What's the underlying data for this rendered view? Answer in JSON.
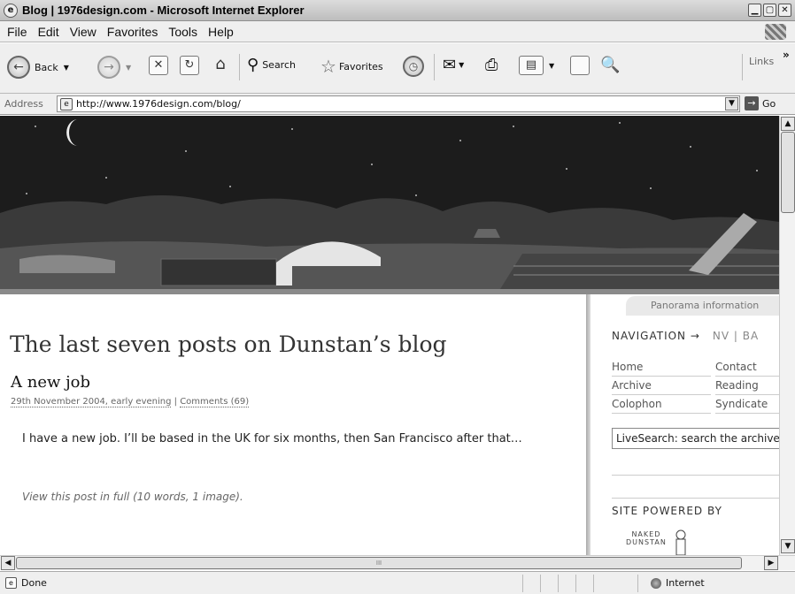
{
  "window": {
    "title": "Blog | 1976design.com - Microsoft Internet Explorer",
    "app_icon": "ie-icon"
  },
  "menu": [
    "File",
    "Edit",
    "View",
    "Favorites",
    "Tools",
    "Help"
  ],
  "toolbar": {
    "back": "Back",
    "search": "Search",
    "favorites": "Favorites",
    "links": "Links",
    "more": "»"
  },
  "address": {
    "label": "Address",
    "url": "http://www.1976design.com/blog/",
    "go": "Go"
  },
  "page": {
    "heading": "The last seven posts on Dunstan’s blog",
    "post": {
      "title": "A new job",
      "meta_date": "29th November 2004, early evening",
      "meta_sep": " | ",
      "meta_comments": "Comments (69)",
      "body": "I have a new job. I’ll be based in the UK for six months, then San Francisco after that…",
      "more": "View this post in full (10 words, 1 image)."
    },
    "sidebar": {
      "panorama_tab": "Panorama information",
      "navigation_title": "NAVIGATION →",
      "navigation_sub": "NV | BA",
      "nav_links": [
        "Home",
        "Contact",
        "Archive",
        "Reading",
        "Colophon",
        "Syndicate"
      ],
      "search_placeholder": "LiveSearch: search the archive",
      "powered_title": "SITE POWERED BY",
      "powered_logo": "NAKED\nDUNSTAN"
    }
  },
  "scrollbar": {
    "hthumb_grip": "III"
  },
  "status": {
    "text": "Done",
    "zone": "Internet"
  },
  "colors": {
    "chrome": "#efefef",
    "sky": "#1c1c1c",
    "banner_bar": "#8a8a8a"
  }
}
